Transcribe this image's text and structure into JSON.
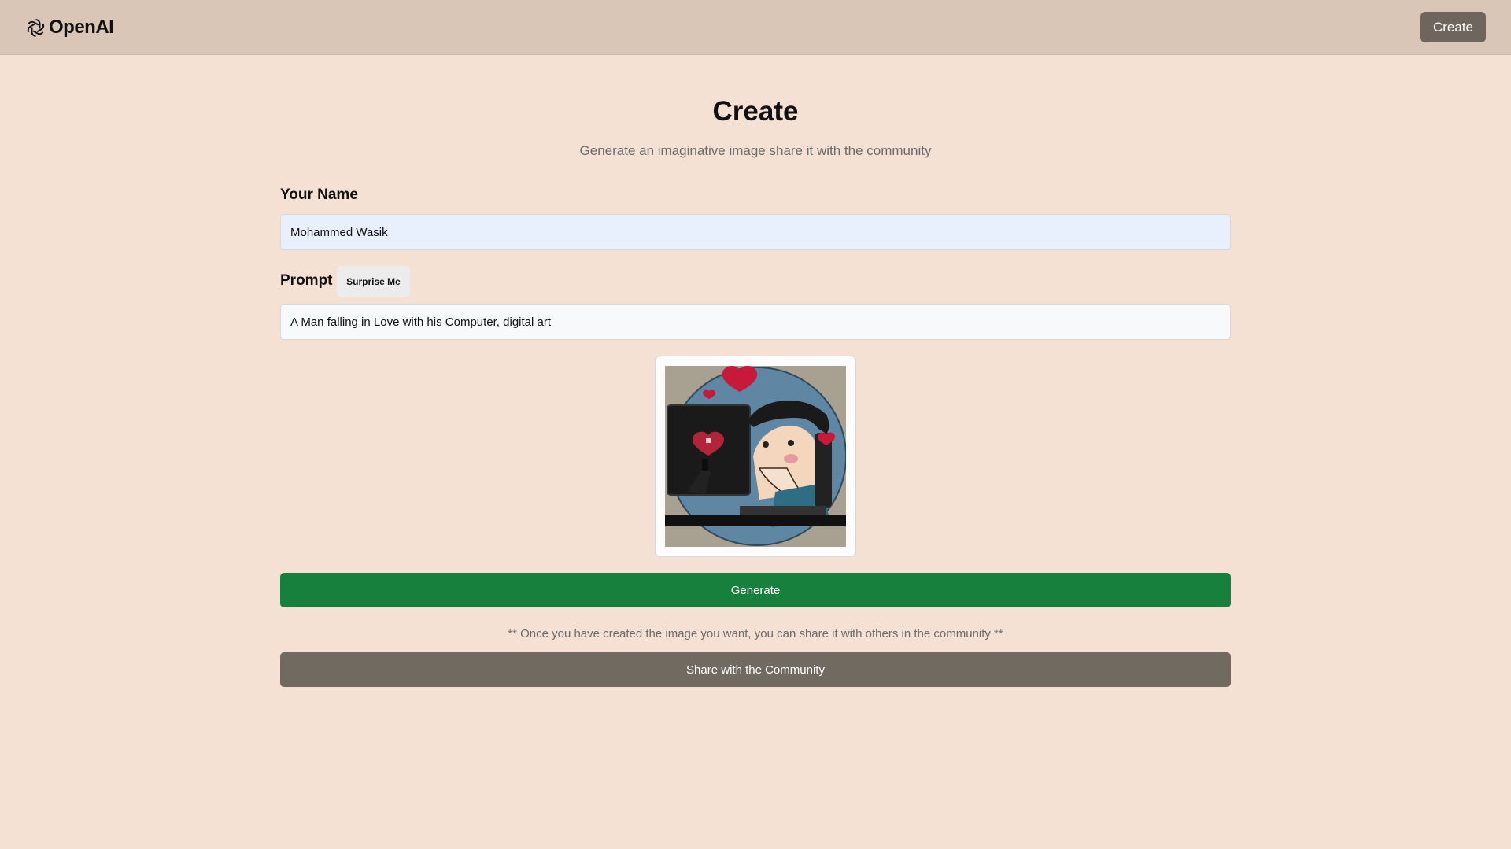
{
  "header": {
    "brand": "OpenAI",
    "logo_icon": "openai-logo-icon",
    "create_label": "Create"
  },
  "page": {
    "title": "Create",
    "subtitle": "Generate an imaginative image share it with the community"
  },
  "form": {
    "name_label": "Your Name",
    "name_value": "Mohammed Wasik",
    "prompt_label": "Prompt",
    "surprise_label": "Surprise Me",
    "prompt_value": "A Man falling in Love with his Computer, digital art"
  },
  "preview": {
    "image_subject": "man-in-love-with-computer-illustration"
  },
  "actions": {
    "generate_label": "Generate",
    "share_note": "** Once you have created the image you want, you can share it with others in the community **",
    "share_label": "Share with the Community"
  },
  "colors": {
    "page_bg": "#f5e1d3",
    "header_bg": "#dac6b6",
    "generate_bg": "#16803c",
    "share_bg": "#716a60",
    "header_button_bg": "#6e665d"
  }
}
